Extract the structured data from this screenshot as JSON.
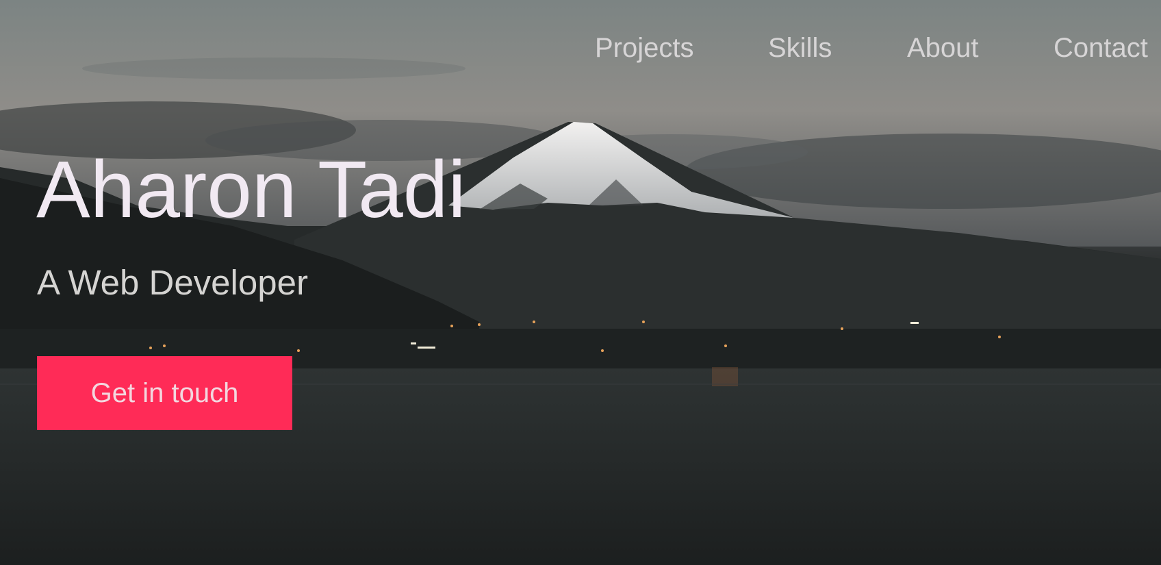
{
  "nav": {
    "items": [
      {
        "label": "Projects"
      },
      {
        "label": "Skills"
      },
      {
        "label": "About"
      },
      {
        "label": "Contact"
      }
    ]
  },
  "hero": {
    "name": "Aharon Tadi",
    "tagline": "A Web Developer",
    "cta_label": "Get in touch",
    "background": "mountain-lake-dusk-photo"
  },
  "colors": {
    "accent": "#ff2b57",
    "heading": "#f1e9f2",
    "nav_text": "#d7d5d6"
  }
}
